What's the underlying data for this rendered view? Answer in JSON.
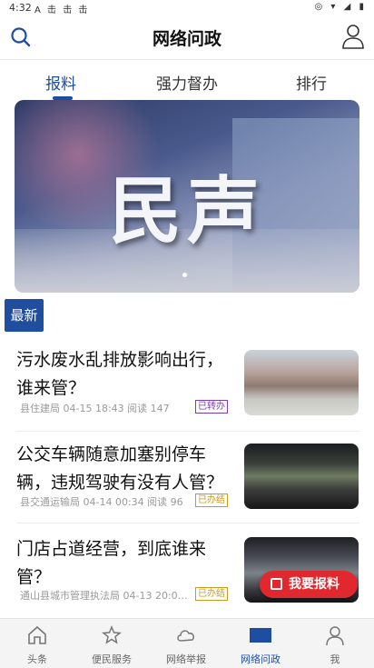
{
  "status_bar": {
    "time": "4:32",
    "left_icons": "A 击 击 击",
    "right_icons": "◎ ▾ ◢ ▮"
  },
  "header": {
    "title": "网络问政"
  },
  "tabs": [
    {
      "label": "报料",
      "active": true
    },
    {
      "label": "强力督办",
      "active": false
    },
    {
      "label": "排行",
      "active": false
    }
  ],
  "banner": {
    "text": "民声"
  },
  "section_label": "最新",
  "news": [
    {
      "title": "污水废水乱排放影响出行，谁来管？",
      "source": "县住建局",
      "time": "04-15 18:43",
      "reads": "阅读 147",
      "status": "已转办",
      "status_color": "#7b3fb0"
    },
    {
      "title": "公交车辆随意加塞别停车辆，违规驾驶有没有人管？",
      "source": "县交通运输局",
      "time": "04-14 00:34",
      "reads": "阅读 96",
      "status": "已办结",
      "status_color": "#c89a1e"
    },
    {
      "title": "门店占道经营，到底谁来管？",
      "source": "通山县城市管理执法局",
      "time": "04-13 20:0…",
      "reads": "",
      "status": "已办结",
      "status_color": "#c89a1e"
    }
  ],
  "fab_label": "我要报料",
  "bottom_nav": [
    {
      "label": "头条",
      "icon": "home-icon",
      "active": false
    },
    {
      "label": "便民服务",
      "icon": "star-hand-icon",
      "active": false
    },
    {
      "label": "网络举报",
      "icon": "cloud-icon",
      "active": false
    },
    {
      "label": "网络问政",
      "icon": "blue-rect-icon",
      "active": true
    },
    {
      "label": "我",
      "icon": "person-icon",
      "active": false
    }
  ],
  "colors": {
    "accent": "#1f4da0",
    "fab": "#e0282e"
  }
}
